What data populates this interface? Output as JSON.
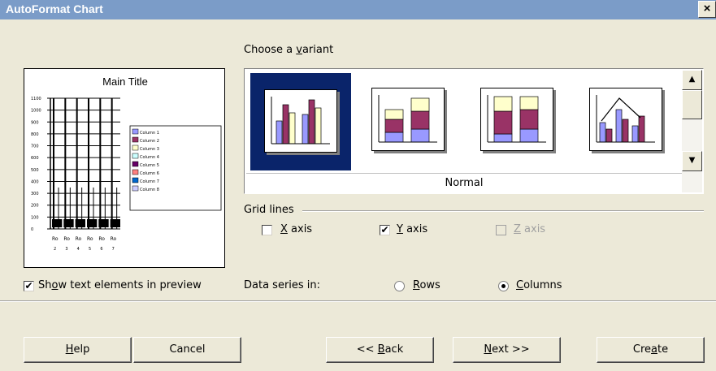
{
  "window": {
    "title": "AutoFormat Chart",
    "close": "×"
  },
  "variant_section": {
    "label_pre": "Choose a ",
    "label_mnemonic": "v",
    "label_post": "ariant",
    "selected_variant": "Normal"
  },
  "preview": {
    "title": "Main Title",
    "y_ticks": [
      "1100",
      "1000",
      "900",
      "800",
      "700",
      "600",
      "500",
      "400",
      "300",
      "200",
      "100",
      "0"
    ],
    "x_labels": [
      "Ro",
      "Ro",
      "Ro",
      "Ro",
      "Ro",
      "Ro"
    ],
    "x_sublabels": [
      "2",
      "3",
      "4",
      "5",
      "6",
      "7"
    ],
    "legend": [
      "Column 1",
      "Column 2",
      "Column 3",
      "Column 4",
      "Column 5",
      "Column 6",
      "Column 7",
      "Column 8"
    ],
    "colors": [
      "#9999ff",
      "#993366",
      "#ffffcc",
      "#ccffff",
      "#660066",
      "#ff8080",
      "#0066cc",
      "#ccccff"
    ]
  },
  "show_text": {
    "checked": true,
    "label_pre": "Sh",
    "label_mnemonic": "o",
    "label_post": "w text elements in preview"
  },
  "grid_lines": {
    "label": "Grid lines",
    "x_axis": {
      "checked": false,
      "mnemonic": "X",
      "rest": " axis"
    },
    "y_axis": {
      "checked": true,
      "mnemonic": "Y",
      "rest": " axis"
    },
    "z_axis": {
      "checked": false,
      "disabled": true,
      "mnemonic": "Z",
      "rest": " axis"
    }
  },
  "data_series": {
    "label": "Data series in:",
    "rows": {
      "mnemonic": "R",
      "rest": "ows",
      "selected": false
    },
    "columns": {
      "mnemonic": "C",
      "rest": "olumns",
      "selected": true
    }
  },
  "buttons": {
    "help": {
      "mnemonic": "H",
      "rest": "elp"
    },
    "cancel": "Cancel",
    "back": {
      "pre": "<< ",
      "mnemonic": "B",
      "rest": "ack"
    },
    "next": {
      "mnemonic": "N",
      "rest": "ext >>"
    },
    "create": {
      "pre": "Cre",
      "mnemonic": "a",
      "rest": "te"
    }
  },
  "icons": {
    "scroll_up": "scroll-up-arrow-icon",
    "scroll_down": "scroll-down-arrow-icon"
  }
}
